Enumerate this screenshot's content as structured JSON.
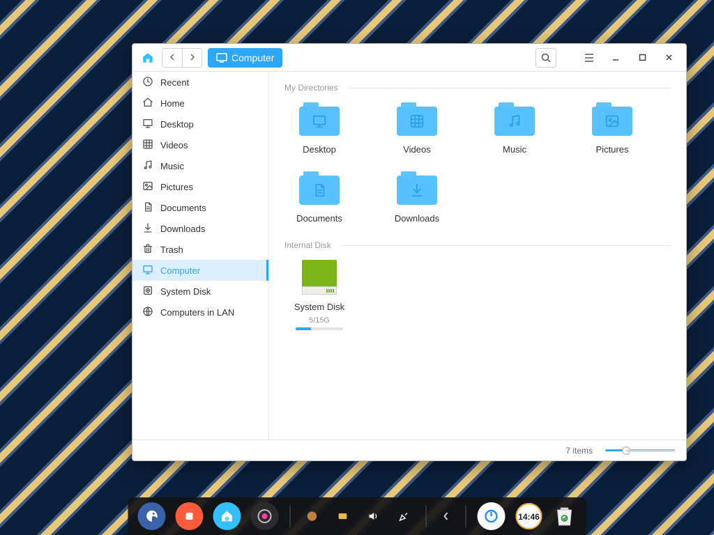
{
  "location_label": "Computer",
  "sidebar": [
    {
      "key": "recent",
      "label": "Recent",
      "icon": "clock"
    },
    {
      "key": "home",
      "label": "Home",
      "icon": "home"
    },
    {
      "key": "desktop",
      "label": "Desktop",
      "icon": "monitor"
    },
    {
      "key": "videos",
      "label": "Videos",
      "icon": "film"
    },
    {
      "key": "music",
      "label": "Music",
      "icon": "music"
    },
    {
      "key": "pictures",
      "label": "Pictures",
      "icon": "image"
    },
    {
      "key": "documents",
      "label": "Documents",
      "icon": "doc"
    },
    {
      "key": "downloads",
      "label": "Downloads",
      "icon": "download"
    },
    {
      "key": "trash",
      "label": "Trash",
      "icon": "trash"
    },
    {
      "key": "computer",
      "label": "Computer",
      "icon": "monitor",
      "active": true
    },
    {
      "key": "systemdisk",
      "label": "System Disk",
      "icon": "disk"
    },
    {
      "key": "lan",
      "label": "Computers in LAN",
      "icon": "globe"
    }
  ],
  "sections": {
    "mydirs_label": "My Directories",
    "internal_label": "Internal Disk"
  },
  "mydirs": [
    {
      "label": "Desktop",
      "icon": "monitor"
    },
    {
      "label": "Videos",
      "icon": "film"
    },
    {
      "label": "Music",
      "icon": "music"
    },
    {
      "label": "Pictures",
      "icon": "image"
    },
    {
      "label": "Documents",
      "icon": "doc"
    },
    {
      "label": "Downloads",
      "icon": "download"
    }
  ],
  "disk": {
    "label": "System Disk",
    "usage_text": "5/15G",
    "usage_pct": 33
  },
  "status": {
    "items": "7 items"
  },
  "dock": [
    {
      "name": "launcher",
      "bg": "#3a62a8"
    },
    {
      "name": "recorder",
      "bg": "#ff5a3c"
    },
    {
      "name": "filemanager",
      "bg": "#34c0ff"
    },
    {
      "name": "settings",
      "bg": "#2b2b2e"
    }
  ],
  "tray": [
    {
      "name": "tray-1"
    },
    {
      "name": "tray-2"
    },
    {
      "name": "volume"
    },
    {
      "name": "picker"
    }
  ],
  "dock_right": [
    {
      "name": "power",
      "bg": "#ffffff"
    },
    {
      "name": "clock",
      "bg": "#ffffff",
      "text": "14:46"
    },
    {
      "name": "trash",
      "bg": "#ffffff"
    }
  ],
  "colors": {
    "accent": "#2ca7f8"
  }
}
